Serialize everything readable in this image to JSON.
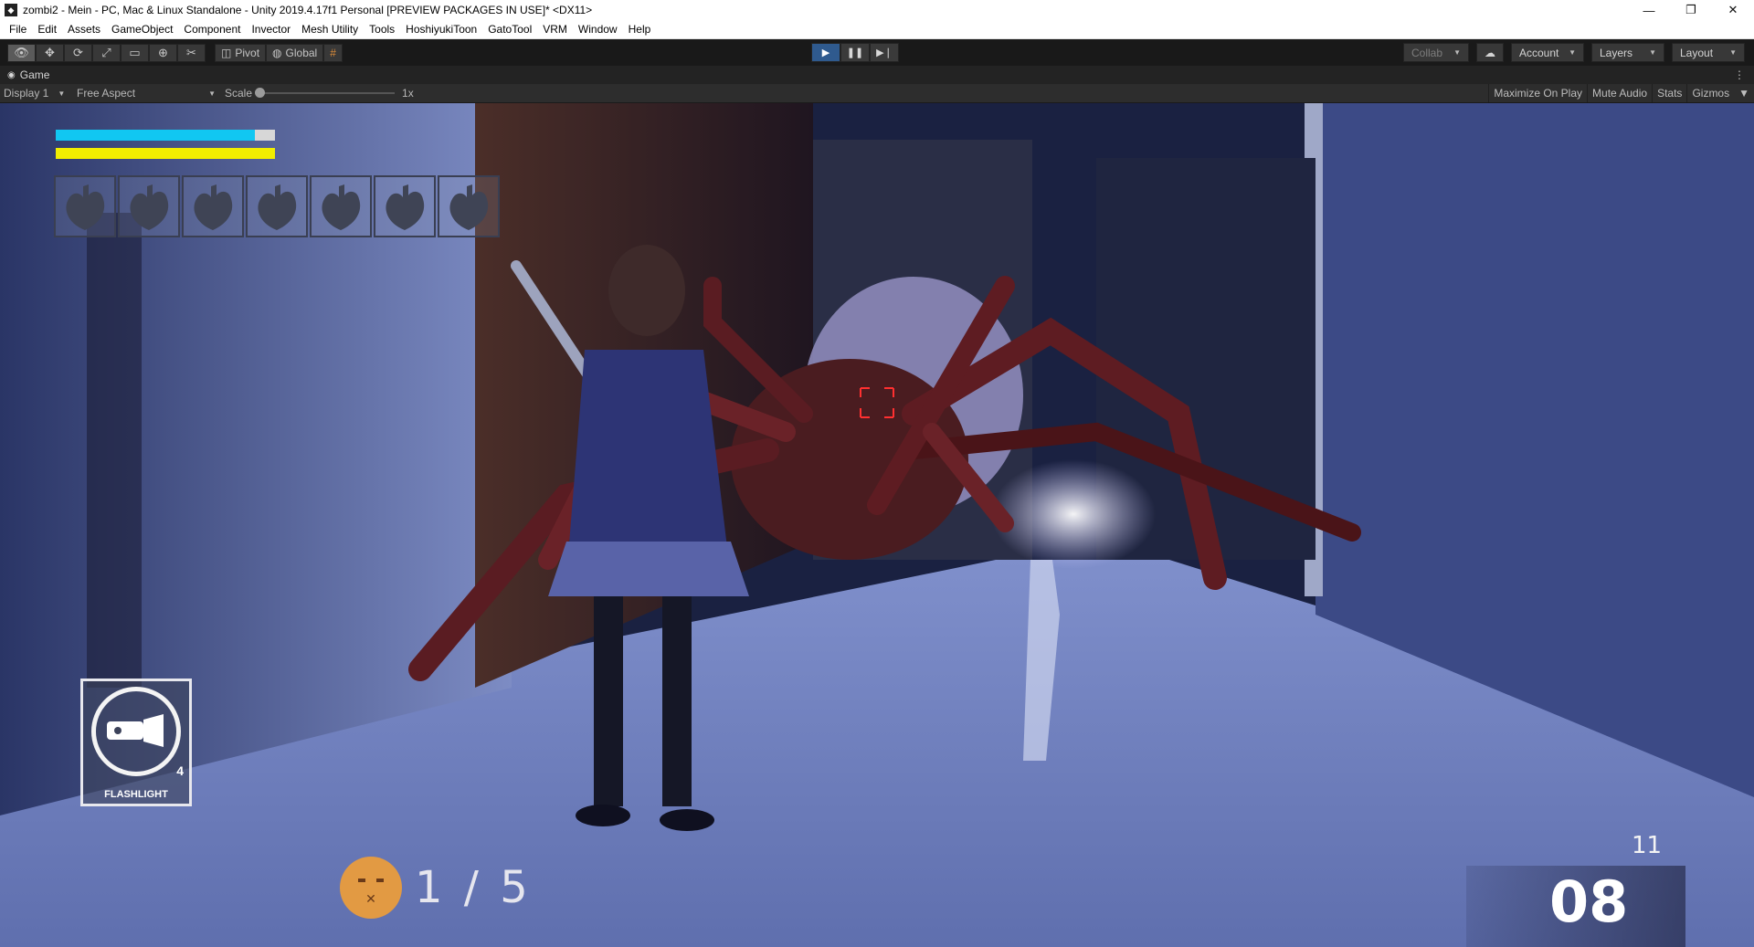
{
  "window": {
    "icon": "unity-icon",
    "title": "zombi2 - Mein - PC, Mac & Linux Standalone - Unity 2019.4.17f1 Personal [PREVIEW PACKAGES IN USE]* <DX11>",
    "controls": [
      "minimize-icon",
      "restore-icon",
      "close-icon"
    ]
  },
  "menu": [
    "File",
    "Edit",
    "Assets",
    "GameObject",
    "Component",
    "Invector",
    "Mesh Utility",
    "Tools",
    "HoshiyukiToon",
    "GatoTool",
    "VRM",
    "Window",
    "Help"
  ],
  "toolbar": {
    "tools": [
      "view-hand-icon",
      "move-icon",
      "rotate-icon",
      "scale-icon",
      "rect-icon",
      "transform-icon",
      "custom-tool-icon"
    ],
    "pivot_label": "Pivot",
    "global_label": "Global",
    "play_state": "playing",
    "collab_label": "Collab",
    "account_label": "Account",
    "layers_label": "Layers",
    "layout_label": "Layout"
  },
  "game_tab": {
    "label": "Game",
    "display": "Display 1",
    "aspect": "Free Aspect",
    "scale_label": "Scale",
    "scale_value": "1x",
    "maximize_on_play": "Maximize On Play",
    "mute_audio": "Mute Audio",
    "stats": "Stats",
    "gizmos": "Gizmos"
  },
  "hud": {
    "health_fraction": 0.91,
    "stamina_fraction": 1.0,
    "health_color": "#11c7f2",
    "stamina_color": "#f2ee00",
    "heart_slots": 7,
    "flashlight_label": "FLASHLIGHT",
    "flashlight_count": "4",
    "quest_progress": "1 / 5",
    "ammo_total": "11",
    "ammo_clip": "08"
  }
}
